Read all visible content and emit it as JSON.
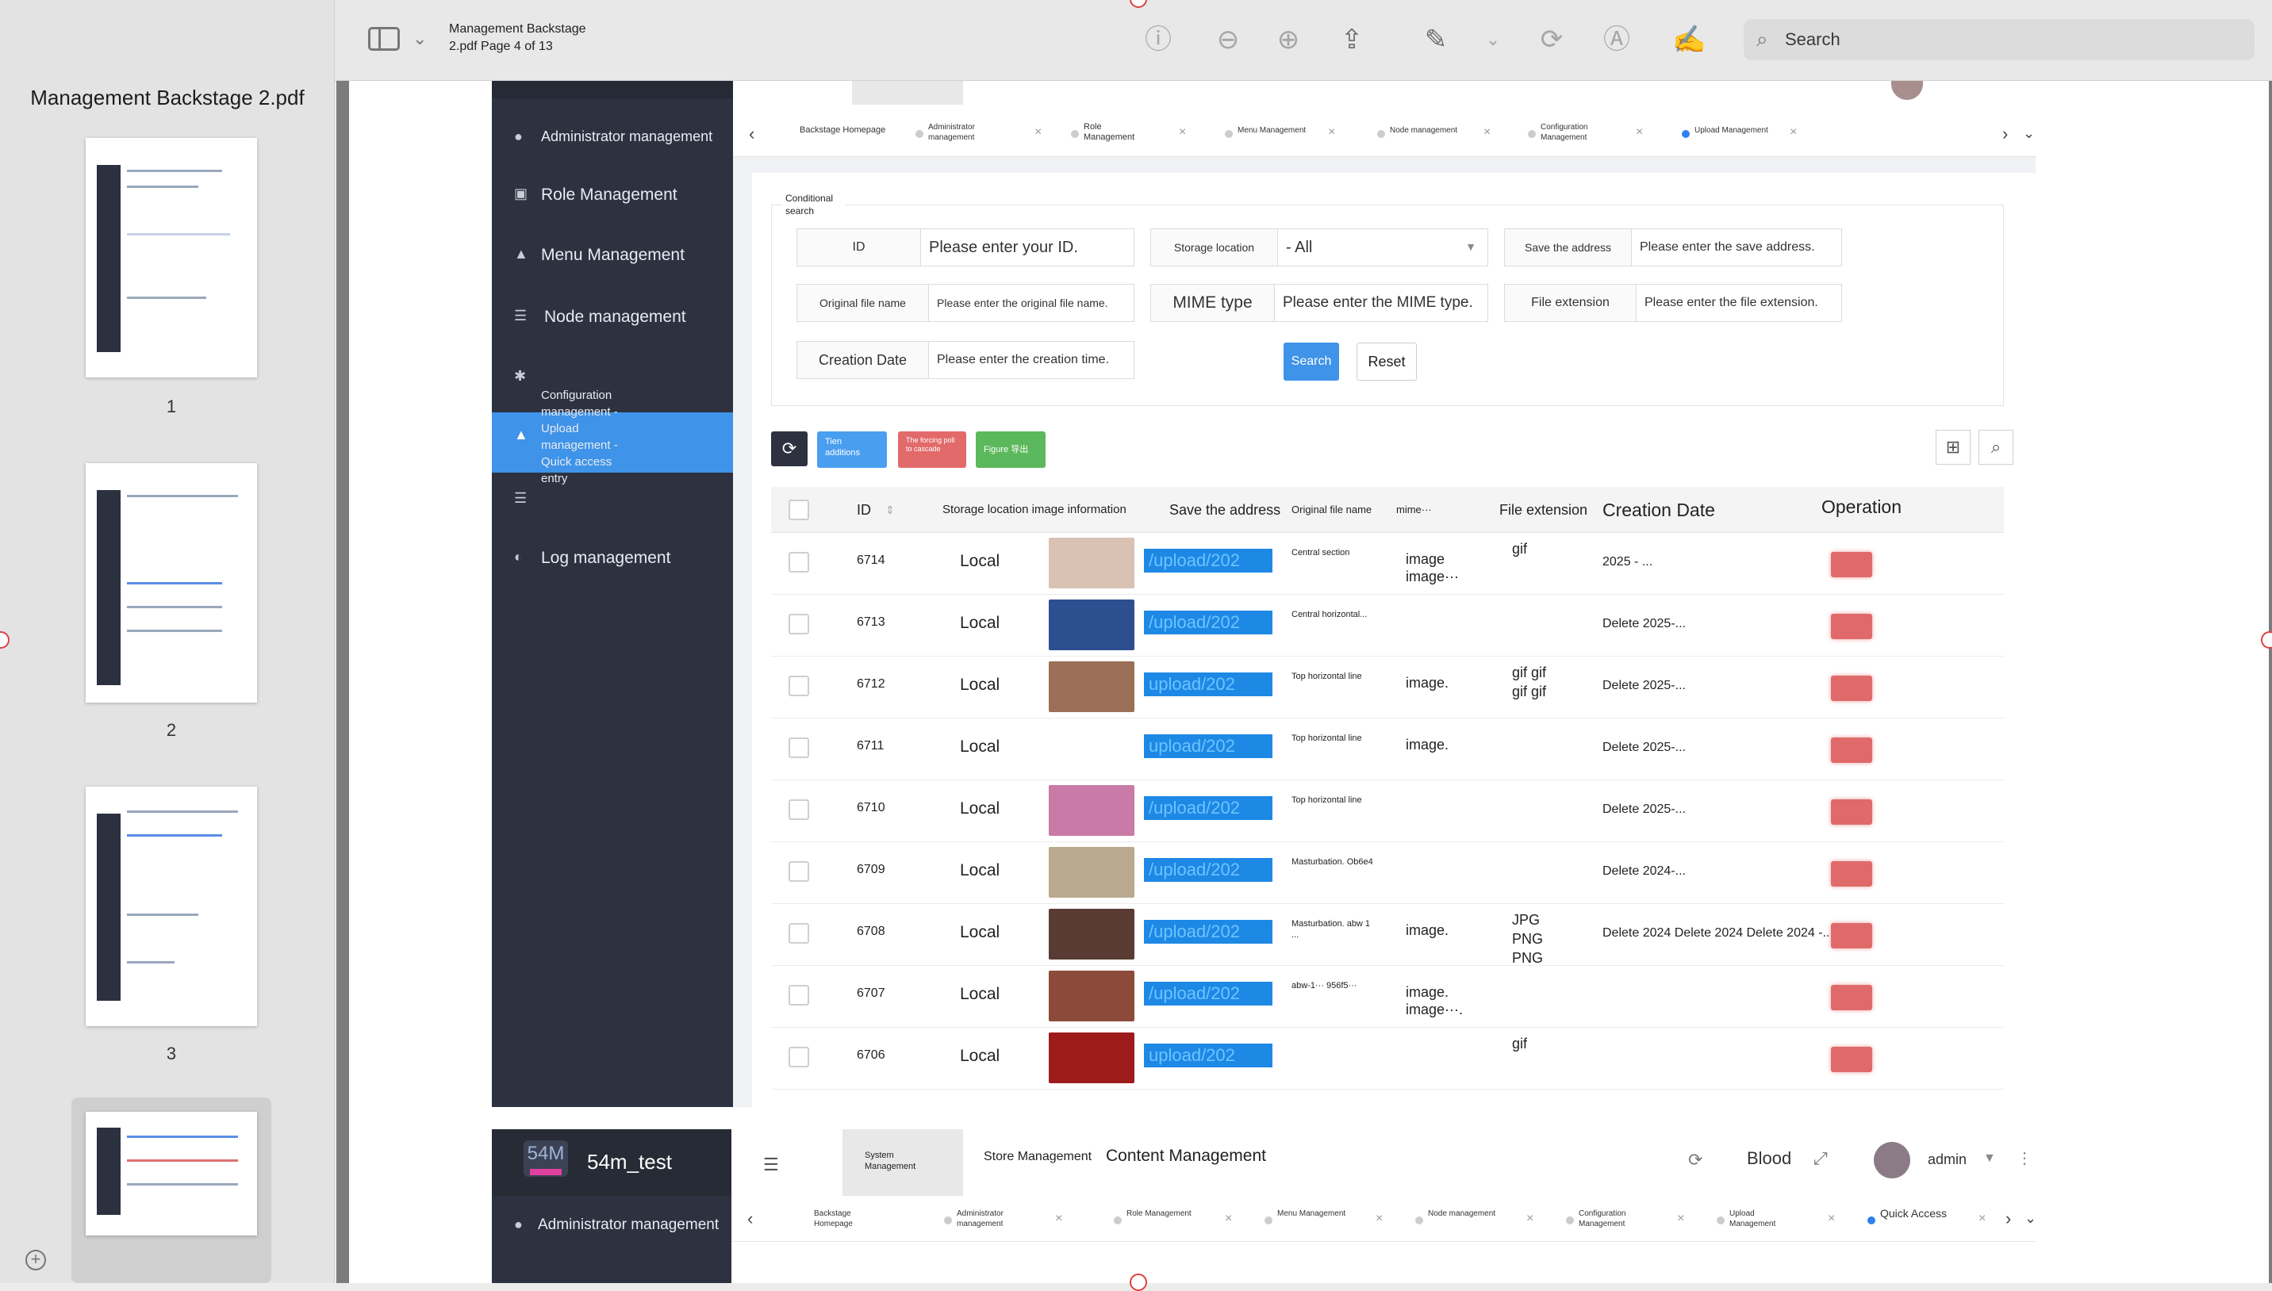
{
  "viewer": {
    "doc_title_line1": "Management Backstage",
    "doc_title_line2": "2.pdf Page 4 of 13",
    "search_placeholder": "Search",
    "sidebar_title": "Management Backstage 2.pdf",
    "thumbnails": [
      {
        "page": "1"
      },
      {
        "page": "2"
      },
      {
        "page": "3"
      },
      {
        "page": "4"
      }
    ],
    "toolbar_icons": [
      "info-icon",
      "zoom-out-icon",
      "zoom-in-icon",
      "share-icon",
      "markup-pen-icon",
      "chevron-down-icon",
      "rotate-icon",
      "highlight-icon",
      "sign-icon"
    ]
  },
  "shot1": {
    "menu": [
      {
        "label": "Administrator management",
        "icon": "user-icon"
      },
      {
        "label": "Role Management",
        "icon": "role-icon"
      },
      {
        "label": "Menu Management",
        "icon": "menu-icon"
      },
      {
        "label": "Node management",
        "icon": "list-icon"
      },
      {
        "label": "Configuration management - Upload management - Quick access entry",
        "icon": "gear-icon"
      },
      {
        "label": "Log management",
        "icon": "log-icon"
      }
    ],
    "tabs": [
      {
        "label": "Backstage Homepage"
      },
      {
        "label": "Administrator management"
      },
      {
        "label": "Role Management"
      },
      {
        "label": "Menu Management"
      },
      {
        "label": "Node management"
      },
      {
        "label": "Configuration Management"
      },
      {
        "label": "Upload Management"
      }
    ],
    "search": {
      "title": "Conditional search",
      "id_label": "ID",
      "id_placeholder": "Please enter your ID.",
      "storage_label": "Storage location",
      "storage_value": "- All",
      "save_label": "Save the address",
      "save_placeholder": "Please enter the save address.",
      "orig_label": "Original file name",
      "orig_placeholder": "Please enter the original file name.",
      "mime_label": "MIME type",
      "mime_placeholder": "Please enter the MIME type.",
      "ext_label": "File extension",
      "ext_placeholder": "Please enter the file extension.",
      "date_label": "Creation Date",
      "date_placeholder": "Please enter the creation time.",
      "search_btn": "Search",
      "reset_btn": "Reset"
    },
    "actions": {
      "add": "Tien additions",
      "delete": "The forcing poll to cascade",
      "export": "Figure 导出"
    },
    "columns": {
      "id": "ID",
      "storage": "Storage location image information",
      "address": "Save the address",
      "orig": "Original file name",
      "mime": "mime···",
      "ext": "File extension",
      "date": "Creation Date",
      "op": "Operation"
    },
    "rows": [
      {
        "id": "6714",
        "loc": "Local",
        "addr": "/upload/202",
        "orig": "Central section",
        "mime": "image image···",
        "ext": "gif",
        "date": "2025 - ...",
        "img": "#d9c2b3"
      },
      {
        "id": "6713",
        "loc": "Local",
        "addr": "/upload/202",
        "orig": "Central horizontal...",
        "mime": "",
        "ext": "",
        "date": "Delete 2025-...",
        "img": "#2d4f8f"
      },
      {
        "id": "6712",
        "loc": "Local",
        "addr": "upload/202",
        "orig": "Top horizontal line",
        "mime": "image.",
        "ext": "gif gif gif gif",
        "date": "Delete 2025-...",
        "img": "#9b6f58"
      },
      {
        "id": "6711",
        "loc": "Local",
        "addr": "upload/202",
        "orig": "Top horizontal line",
        "mime": "image.",
        "ext": "",
        "date": "Delete 2025-...",
        "img": ""
      },
      {
        "id": "6710",
        "loc": "Local",
        "addr": "/upload/202",
        "orig": "Top horizontal line",
        "mime": "",
        "ext": "",
        "date": "Delete 2025-...",
        "img": "#c97aa6"
      },
      {
        "id": "6709",
        "loc": "Local",
        "addr": "/upload/202",
        "orig": "Masturbation. Ob6e4",
        "mime": "",
        "ext": "",
        "date": "Delete 2024-...",
        "img": "#b9a98e"
      },
      {
        "id": "6708",
        "loc": "Local",
        "addr": "/upload/202",
        "orig": "Masturbation. abw 1 ...",
        "mime": "image.",
        "ext": "JPG PNG PNG",
        "date": "Delete 2024 Delete 2024 Delete 2024 -...",
        "img": "#5a3b34"
      },
      {
        "id": "6707",
        "loc": "Local",
        "addr": "/upload/202",
        "orig": "abw-1··· 956f5···",
        "mime": "image. image···.",
        "ext": "",
        "date": "",
        "img": "#8c4a3a"
      },
      {
        "id": "6706",
        "loc": "Local",
        "addr": "upload/202",
        "orig": "",
        "mime": "",
        "ext": "gif",
        "date": "",
        "img": "#9e1b1b"
      }
    ]
  },
  "shot2": {
    "logo": "54M",
    "app": "54m_test",
    "header_tabs": [
      "System Management",
      "Store Management",
      "Content Management"
    ],
    "blood": "Blood",
    "user": "admin",
    "menu_first": "Administrator management",
    "tabs": [
      "Backstage Homepage",
      "Administrator management",
      "Role Management",
      "Menu Management",
      "Node management",
      "Configuration Management",
      "Upload Management",
      "Quick Access"
    ]
  },
  "colors": {
    "sidebar": "#2e3240",
    "accent": "#3f93e8",
    "danger": "#e06a6a",
    "success": "#5cb85c"
  }
}
